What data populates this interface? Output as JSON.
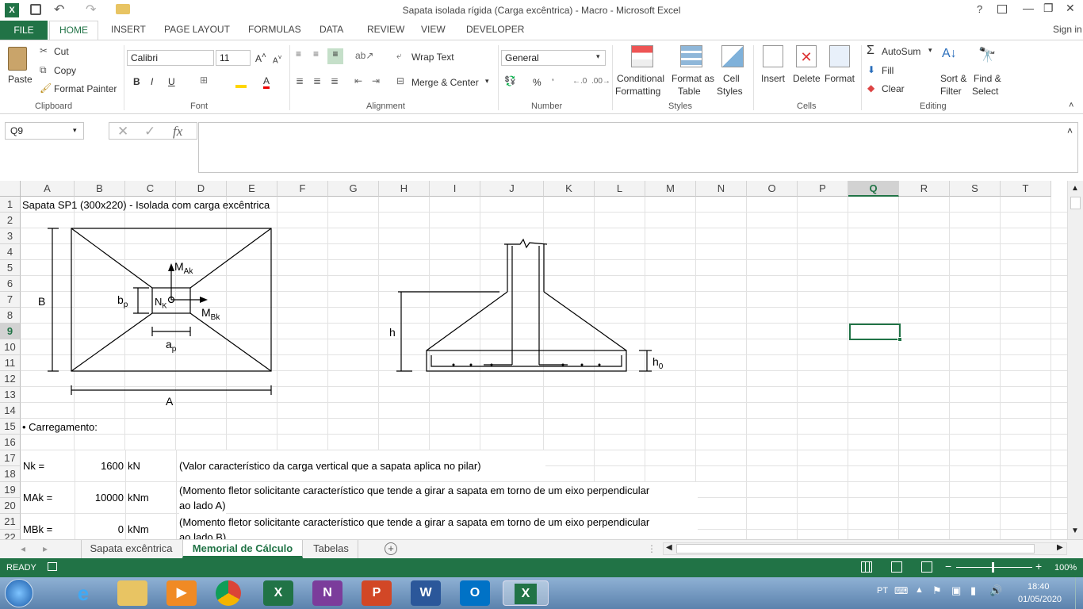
{
  "window": {
    "title": "Sapata isolada rígida (Carga excêntrica) - Macro - Microsoft Excel",
    "help": "?",
    "controls": [
      "—",
      "❐",
      "✕"
    ]
  },
  "ribbon_tabs": [
    "FILE",
    "HOME",
    "INSERT",
    "PAGE LAYOUT",
    "FORMULAS",
    "DATA",
    "REVIEW",
    "VIEW",
    "DEVELOPER"
  ],
  "sign_in": "Sign in",
  "clipboard": {
    "paste": "Paste",
    "cut": "Cut",
    "copy": "Copy",
    "format_painter": "Format Painter",
    "label": "Clipboard"
  },
  "font": {
    "name": "Calibri",
    "size": "11",
    "bold": "B",
    "italic": "I",
    "underline": "U",
    "label": "Font"
  },
  "alignment": {
    "wrap": "Wrap Text",
    "merge": "Merge & Center",
    "label": "Alignment"
  },
  "number": {
    "format": "General",
    "percent": "%",
    "comma": "’",
    "label": "Number"
  },
  "styles": {
    "conditional": "Conditional",
    "conditional2": "Formatting",
    "format_as": "Format as",
    "format_as2": "Table",
    "cell": "Cell",
    "cell2": "Styles",
    "label": "Styles"
  },
  "cells": {
    "insert": "Insert",
    "delete": "Delete",
    "format": "Format",
    "label": "Cells"
  },
  "editing": {
    "autosum": "AutoSum",
    "fill": "Fill",
    "clear": "Clear",
    "sort": "Sort &",
    "sort2": "Filter",
    "find": "Find &",
    "find2": "Select",
    "label": "Editing"
  },
  "name_box": "Q9",
  "fx": "fx",
  "columns": [
    "A",
    "B",
    "C",
    "D",
    "E",
    "F",
    "G",
    "H",
    "I",
    "J",
    "K",
    "L",
    "M",
    "N",
    "O",
    "P",
    "Q",
    "R",
    "S",
    "T"
  ],
  "rows": [
    "1",
    "2",
    "3",
    "4",
    "5",
    "6",
    "7",
    "8",
    "9",
    "10",
    "11",
    "12",
    "13",
    "14",
    "15",
    "16",
    "17",
    "18",
    "19",
    "20",
    "21",
    "22"
  ],
  "sheet": {
    "heading": "Sapata SP1 (300x220) - Isolada com carga excêntrica",
    "carregamento": "• Carregamento:",
    "nk_label": "Nk =",
    "nk_value": "1600",
    "nk_unit": "kN",
    "nk_desc": "(Valor característico da carga vertical que a sapata aplica no pilar)",
    "mak_label": "MAk =",
    "mak_value": "10000",
    "mak_unit": "kNm",
    "mak_desc1": "(Momento fletor solicitante característico que tende a girar a sapata em torno de um eixo perpendicular",
    "mak_desc2": "ao lado A)",
    "mbk_label": "MBk =",
    "mbk_value": "0",
    "mbk_unit": "kNm",
    "mbk_desc1": "(Momento fletor solicitante característico que tende a girar a sapata em torno de um eixo perpendicular",
    "mbk_desc2": "ao lado B)"
  },
  "drawing_labels": {
    "B": "B",
    "A": "A",
    "bp": "b",
    "bp_sub": "p",
    "ap": "a",
    "ap_sub": "p",
    "nk": "N",
    "nk_sub": "K",
    "mak": "M",
    "mak_sub": "Ak",
    "mbk": "M",
    "mbk_sub": "Bk",
    "h": "h",
    "h0": "h",
    "h0_sub": "0"
  },
  "sheet_tabs": [
    "Sapata excêntrica",
    "Memorial de Cálculo",
    "Tabelas"
  ],
  "status": {
    "ready": "READY",
    "zoom": "100%"
  },
  "taskbar": {
    "lang": "PT",
    "time": "18:40",
    "date": "01/05/2020"
  },
  "colors": {
    "excel_green": "#217346",
    "selected_header": "#d2d2d2"
  }
}
